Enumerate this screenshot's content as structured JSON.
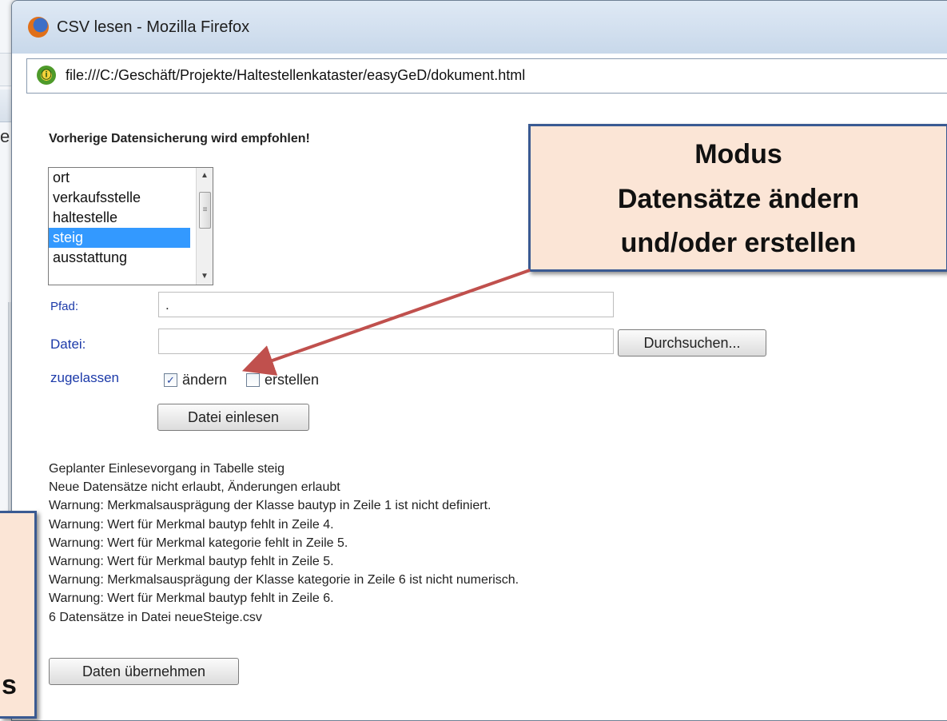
{
  "background": {
    "fragment_char": "e"
  },
  "window": {
    "title": "CSV lesen - Mozilla Firefox",
    "url": "file:///C:/Geschäft/Projekte/Haltestellenkataster/easyGeD/dokument.html"
  },
  "form": {
    "notice": "Vorherige Datensicherung wird empfohlen!",
    "tables": {
      "items": [
        "ort",
        "verkaufsstelle",
        "haltestelle",
        "steig",
        "ausstattung"
      ],
      "selected": "steig"
    },
    "path_label": "Pfad:",
    "path_value": ".",
    "file_label": "Datei:",
    "file_value": "",
    "browse_label": "Durchsuchen...",
    "allowed_label": "zugelassen",
    "change_label": "ändern",
    "change_checked": true,
    "create_label": "erstellen",
    "create_checked": false,
    "read_button": "Datei einlesen"
  },
  "log": {
    "lines": [
      "Geplanter Einlesevorgang in Tabelle steig",
      "Neue Datensätze nicht erlaubt, Änderungen erlaubt",
      "Warnung: Merkmalsausprägung der Klasse bautyp in Zeile 1 ist nicht definiert.",
      "Warnung: Wert für Merkmal bautyp fehlt in Zeile 4.",
      "Warnung: Wert für Merkmal kategorie fehlt in Zeile 5.",
      "Warnung: Wert für Merkmal bautyp fehlt in Zeile 5.",
      "Warnung: Merkmalsausprägung der Klasse kategorie in Zeile 6 ist nicht numerisch.",
      "Warnung: Wert für Merkmal bautyp fehlt in Zeile 6.",
      "6 Datensätze in Datei neueSteige.csv"
    ],
    "apply_button": "Daten übernehmen"
  },
  "callout": {
    "line1": "Modus",
    "line2": "Datensätze ändern",
    "line3": "und/oder erstellen"
  },
  "callout_left": {
    "fragment": "s"
  },
  "colors": {
    "label_blue": "#1c3aa9",
    "selection": "#3399ff",
    "callout_fill": "#fbe5d6",
    "callout_border": "#3a5a92",
    "arrow": "#c0504d"
  },
  "icons": {
    "window": "firefox-icon",
    "url": "page-identity-icon"
  }
}
